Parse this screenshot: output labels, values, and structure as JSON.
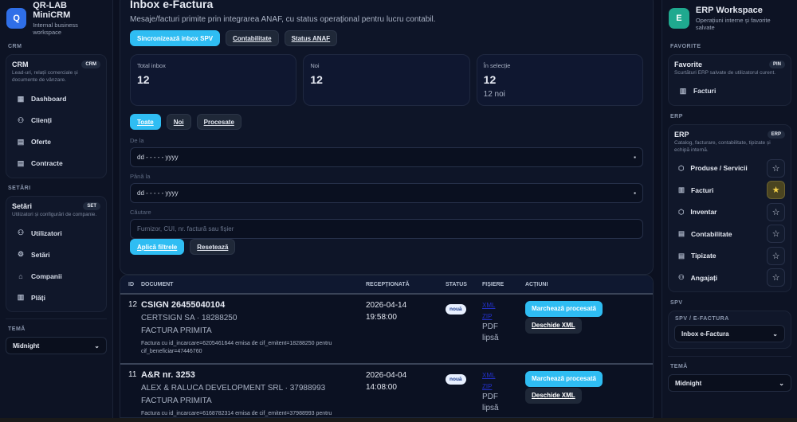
{
  "left": {
    "brand": {
      "logo": "Q",
      "title": "QR-LAB MiniCRM",
      "subtitle": "Internal business workspace",
      "color": "#2f6fe8"
    },
    "sections": [
      {
        "label": "CRM",
        "title": "CRM",
        "pill": "CRM",
        "desc": "Lead-uri, relații comerciale și documente de vânzare.",
        "items": [
          {
            "icon": "dashboard-icon",
            "glyph": "▦",
            "label": "Dashboard"
          },
          {
            "icon": "user-icon",
            "glyph": "⚇",
            "label": "Clienți"
          },
          {
            "icon": "document-icon",
            "glyph": "▤",
            "label": "Oferte"
          },
          {
            "icon": "document-icon",
            "glyph": "▤",
            "label": "Contracte"
          }
        ]
      },
      {
        "label": "SETĂRI",
        "title": "Setări",
        "pill": "SET",
        "desc": "Utilizatori și configurări de companie.",
        "items": [
          {
            "icon": "users-icon",
            "glyph": "⚇",
            "label": "Utilizatori"
          },
          {
            "icon": "gear-icon",
            "glyph": "⚙",
            "label": "Setări"
          },
          {
            "icon": "building-icon",
            "glyph": "⌂",
            "label": "Companii"
          },
          {
            "icon": "receipt-icon",
            "glyph": "▥",
            "label": "Plăți"
          }
        ]
      }
    ],
    "theme_label": "TEMĂ",
    "theme_value": "Midnight"
  },
  "main": {
    "title": "Inbox e-Factura",
    "subtitle": "Mesaje/facturi primite prin integrarea ANAF, cu status operațional pentru lucru contabil.",
    "actions": [
      "Sincronizează inbox SPV",
      "Contabilitate",
      "Status ANAF"
    ],
    "stats": [
      {
        "label": "Total inbox",
        "value": "12",
        "sub": ""
      },
      {
        "label": "Noi",
        "value": "12",
        "sub": ""
      },
      {
        "label": "În selecție",
        "value": "12",
        "sub": "12 noi"
      }
    ],
    "filters": [
      "Toate",
      "Noi",
      "Procesate"
    ],
    "from_label": "De la",
    "from_value": "dd - - - - - yyyy",
    "to_label": "Până la",
    "to_value": "dd - - - - - yyyy",
    "search_label": "Căutare",
    "search_placeholder": "Furnizor, CUI, nr. factură sau fișier",
    "apply": "Aplică filtrele",
    "reset": "Resetează"
  },
  "table": {
    "headers": [
      "ID",
      "DOCUMENT",
      "RECEPȚIONATĂ",
      "STATUS",
      "FIȘIERE",
      "ACȚIUNI"
    ],
    "rows": [
      {
        "id": "12",
        "title": "CSIGN 26455040104",
        "meta": "CERTSIGN SA · 18288250",
        "type": "FACTURA PRIMITA",
        "desc": "Factura cu id_incarcare=6205461644 emisa de cif_emitent=18288250 pentru cif_beneficiar=47446760",
        "date": "2026-04-14",
        "time": "19:58:00",
        "status": "nouă",
        "files": [
          "XML",
          "ZIP"
        ],
        "pdf": "PDF lipsă",
        "act1": "Marchează procesată",
        "act2": "Deschide XML"
      },
      {
        "id": "11",
        "title": "A&R nr. 3253",
        "meta": "ALEX & RALUCA DEVELOPMENT SRL · 37988993",
        "type": "FACTURA PRIMITA",
        "desc": "Factura cu id_incarcare=6168782314 emisa de cif_emitent=37988993 pentru",
        "date": "2026-04-04",
        "time": "14:08:00",
        "status": "nouă",
        "files": [
          "XML",
          "ZIP"
        ],
        "pdf": "PDF lipsă",
        "act1": "Marchează procesată",
        "act2": "Deschide XML"
      }
    ]
  },
  "right": {
    "brand": {
      "logo": "E",
      "title": "ERP Workspace",
      "subtitle": "Operațiuni interne și favorite salvate",
      "color": "#1fa98f"
    },
    "fav": {
      "label": "FAVORITE",
      "title": "Favorite",
      "pill": "PIN",
      "desc": "Scurtături ERP salvate de utilizatorul curent.",
      "items": [
        {
          "label": "Facturi"
        }
      ]
    },
    "erp": {
      "label": "ERP",
      "title": "ERP",
      "pill": "ERP",
      "desc": "Catalog, facturare, contabilitate, tipizate și echipă internă.",
      "items": [
        {
          "glyph": "⬡",
          "label": "Produse / Servicii",
          "starred": false
        },
        {
          "glyph": "▥",
          "label": "Facturi",
          "starred": true
        },
        {
          "glyph": "⬡",
          "label": "Inventar",
          "starred": false
        },
        {
          "glyph": "▤",
          "label": "Contabilitate",
          "starred": false
        },
        {
          "glyph": "▤",
          "label": "Tipizate",
          "starred": false
        },
        {
          "glyph": "⚇",
          "label": "Angajați",
          "starred": false
        }
      ]
    },
    "spv": {
      "label": "SPV",
      "inner": "SPV / E-FACTURA",
      "value": "Inbox e-Factura"
    },
    "theme_label": "TEMĂ",
    "theme_value": "Midnight"
  }
}
